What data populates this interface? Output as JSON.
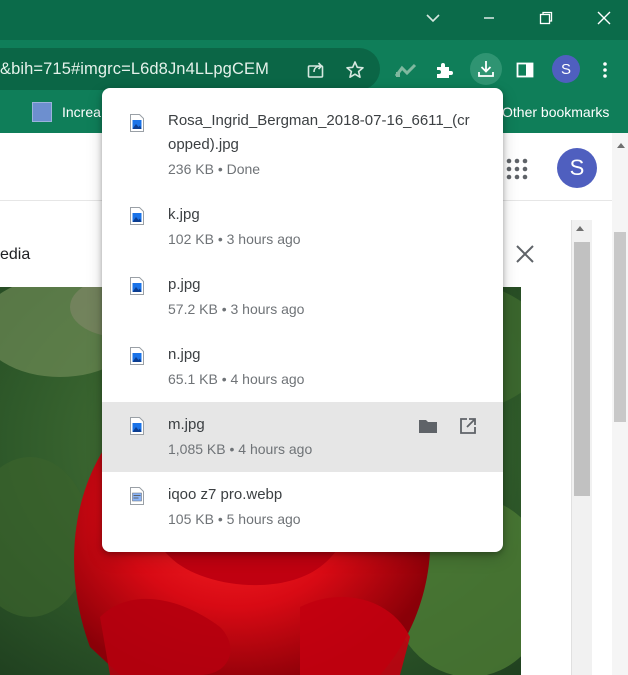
{
  "browser": {
    "url_fragment": "&bih=715#imgrc=L6d8Jn4LLpgCEM",
    "profile_initial": "S",
    "bookmarks": {
      "first_label": "Increa",
      "other_label": "Other bookmarks"
    },
    "icons": {
      "chevron": "chevron-down-icon",
      "minimize": "minimize-icon",
      "restore": "restore-icon",
      "close": "close-icon",
      "share": "share-icon",
      "star": "bookmark-star-icon",
      "analytics": "analytics-extension-icon",
      "puzzle": "extensions-puzzle-icon",
      "download": "download-icon",
      "sidepanel": "side-panel-icon",
      "menu": "three-dot-menu-icon"
    },
    "colors": {
      "titlebar": "#0b6b4a",
      "toolbar": "#0f7e59",
      "avatar": "#4f5fbf"
    }
  },
  "page": {
    "profile_initial": "S",
    "panel_title_partial": "edia"
  },
  "downloads": {
    "items": [
      {
        "name_line1": "Rosa_Ingrid_Bergman_2018-07-16_6611_(cr",
        "name_line2": "opped).jpg",
        "status": "236 KB • Done",
        "icon": "image-file-icon"
      },
      {
        "name": "k.jpg",
        "status": "102 KB • 3 hours ago",
        "icon": "image-file-icon"
      },
      {
        "name": "p.jpg",
        "status": "57.2 KB • 3 hours ago",
        "icon": "image-file-icon"
      },
      {
        "name": "n.jpg",
        "status": "65.1 KB • 4 hours ago",
        "icon": "image-file-icon"
      },
      {
        "name": "m.jpg",
        "status": "1,085 KB • 4 hours ago",
        "icon": "image-file-icon",
        "hovered": true,
        "actions": [
          "folder-icon",
          "open-external-icon"
        ]
      },
      {
        "name": "iqoo z7 pro.webp",
        "status": "105 KB • 5 hours ago",
        "icon": "webp-file-icon"
      }
    ]
  }
}
